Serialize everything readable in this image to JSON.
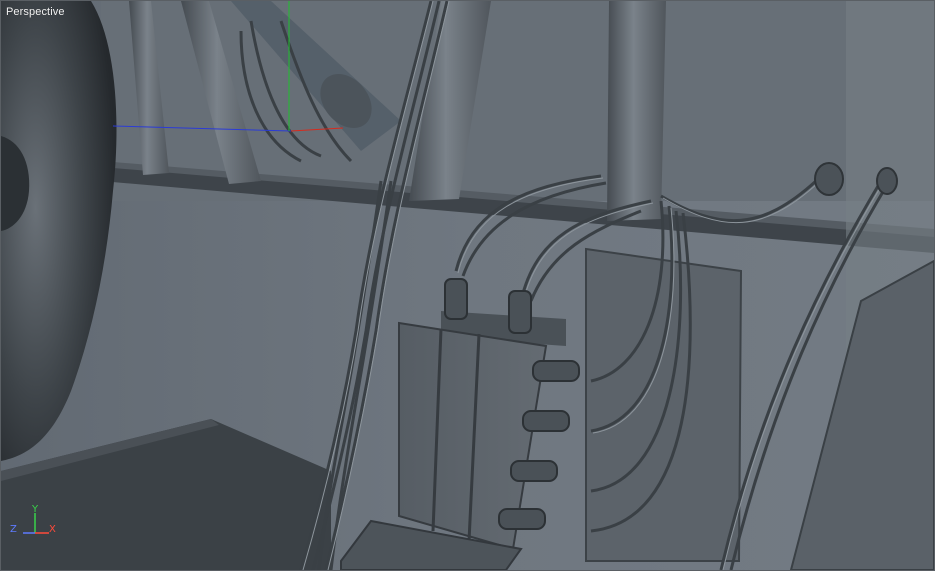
{
  "viewport": {
    "view_name": "Perspective"
  },
  "axis_gizmo": {
    "x_label": "X",
    "y_label": "Y",
    "z_label": "Z",
    "x_color": "#ff4a3a",
    "y_color": "#39d24a",
    "z_color": "#5e7bff"
  },
  "scene": {
    "background_color": "#6b737c",
    "object_color": "#4f565d"
  }
}
